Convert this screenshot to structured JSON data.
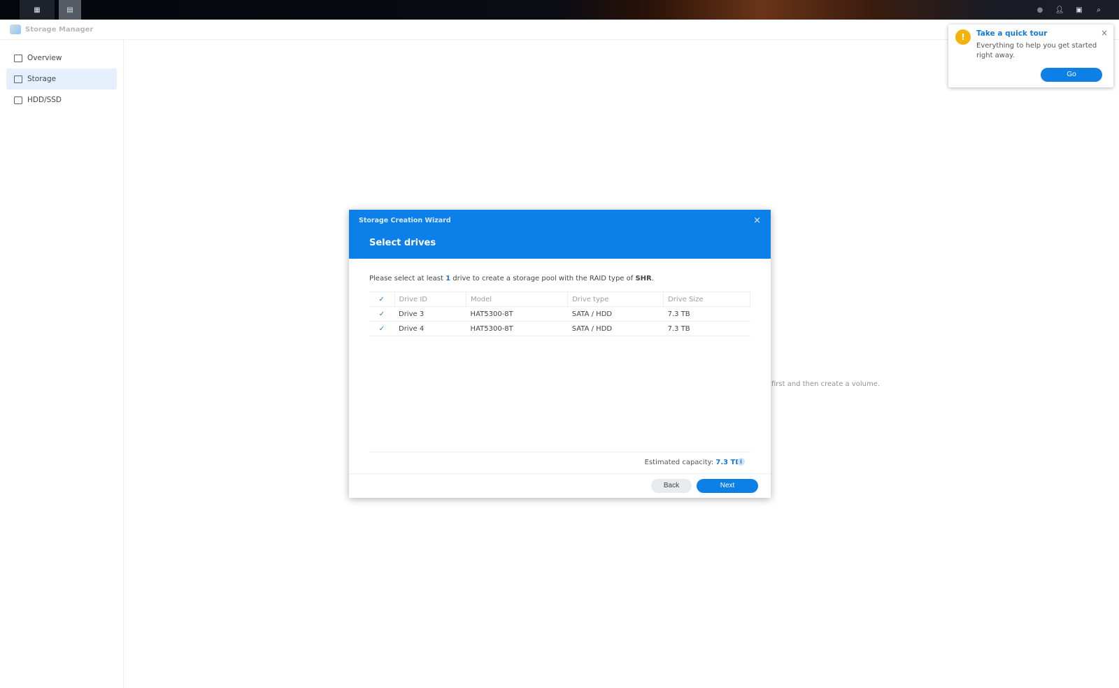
{
  "taskbar": {
    "icons": [
      "main-menu-icon",
      "storage-manager-app-icon",
      "chat-icon",
      "user-icon",
      "widgets-icon",
      "search-icon"
    ]
  },
  "window": {
    "title": "Storage Manager"
  },
  "sidebar": {
    "items": [
      {
        "label": "Overview",
        "icon": "overview-icon"
      },
      {
        "label": "Storage",
        "icon": "storage-icon",
        "active": true
      },
      {
        "label": "HDD/SSD",
        "icon": "hdd-icon"
      }
    ]
  },
  "background_text": "first and then create a volume.",
  "tour": {
    "title": "Take a quick tour",
    "text": "Everything to help you get started right away.",
    "go": "Go",
    "close": "×"
  },
  "wizard": {
    "window_title": "Storage Creation Wizard",
    "step_title": "Select drives",
    "desc_pre": "Please select at least ",
    "desc_count": "1",
    "desc_mid": " drive to create a storage pool with the RAID type of ",
    "desc_raid": "SHR",
    "desc_post": ".",
    "columns": [
      "Drive ID",
      "Model",
      "Drive type",
      "Drive Size"
    ],
    "rows": [
      {
        "id": "Drive 3",
        "model": "HAT5300-8T",
        "type": "SATA / HDD",
        "size": "7.3 TB",
        "checked": true
      },
      {
        "id": "Drive 4",
        "model": "HAT5300-8T",
        "type": "SATA / HDD",
        "size": "7.3 TB",
        "checked": true
      }
    ],
    "capacity_label": "Estimated capacity: ",
    "capacity_value": "7.3 TB",
    "back": "Back",
    "next": "Next",
    "close": "×"
  },
  "colors": {
    "accent": "#0c80e8",
    "warning": "#f4b20e"
  }
}
